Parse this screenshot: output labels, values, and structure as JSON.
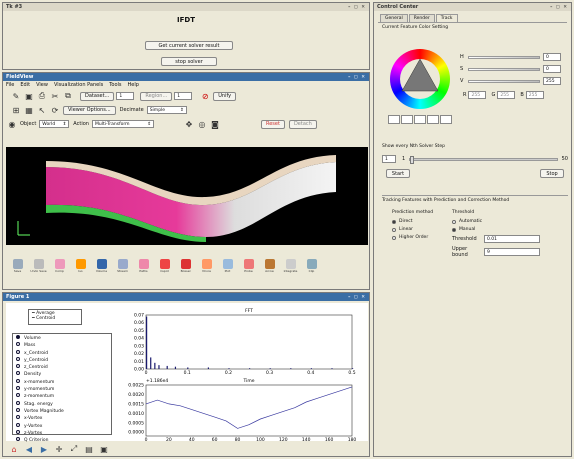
{
  "ifdt": {
    "win_title": "Tk #3",
    "title": "IFDT",
    "btn_get": "Get current solver result",
    "btn_stop": "stop solver"
  },
  "fv": {
    "win_title": "FieldView",
    "menu": [
      "File",
      "Edit",
      "View",
      "Visualization Panels",
      "Tools",
      "Help"
    ],
    "dataset_label": "Dataset...",
    "dataset_val": "1",
    "region_label": "Region...",
    "region_val": "1",
    "unify": "Unify",
    "viewer_options": "Viewer Options...",
    "decimate_label": "Decimate",
    "decimate_val": "Simple",
    "object_label": "Object",
    "object_val": "World",
    "action_label": "Action",
    "action_val": "Multi-Transform",
    "reset": "Reset",
    "detach": "Detach",
    "tools": [
      "Save",
      "Undo Save",
      "Comp",
      "Iso",
      "Volume",
      "Stream",
      "Paths",
      "Cspot",
      "Boxsel",
      "VCore",
      "Plot",
      "Probe",
      "Arrow",
      "Integrate",
      "Clip"
    ]
  },
  "fig": {
    "win_title": "Figure 1",
    "legend": [
      "Average",
      "Centroid"
    ],
    "vars": [
      "Volume",
      "Mass",
      "x_Centroid",
      "y_Centroid",
      "z_Centroid",
      "Density",
      "x-momentum",
      "y-momentum",
      "z-momentum",
      "Stag. energy",
      "Vortex Magnitude",
      "x-Vortex",
      "y-Vortex",
      "z-Vortex",
      "Q Criterion"
    ],
    "fft_title": "FFT",
    "fft_yticks": [
      "0.07",
      "0.06",
      "0.05",
      "0.04",
      "0.03",
      "0.02",
      "0.01",
      "0.00"
    ],
    "fft_xticks": [
      "0",
      "0.1",
      "0.2",
      "0.3",
      "0.4",
      "0.5"
    ],
    "time_title": "Time",
    "time_exp": "+1.186e4",
    "time_yticks": [
      "0.0025",
      "0.0020",
      "0.0015",
      "0.0010",
      "0.0005",
      "0.0000"
    ],
    "time_xticks": [
      "0",
      "20",
      "40",
      "60",
      "80",
      "100",
      "120",
      "140",
      "160",
      "180"
    ]
  },
  "cc": {
    "win_title": "Control Center",
    "tabs": [
      "General",
      "Render",
      "Track"
    ],
    "color_title": "Current Feature Color Setting",
    "hsv": [
      {
        "l": "H",
        "v": "0"
      },
      {
        "l": "S",
        "v": "0"
      },
      {
        "l": "V",
        "v": "255"
      }
    ],
    "rgb": [
      {
        "l": "R",
        "v": "255"
      },
      {
        "l": "G",
        "v": "255"
      },
      {
        "l": "B",
        "v": "255"
      }
    ],
    "step_title": "Show every Nth Solver Step",
    "step_val": "1",
    "step_min": "1",
    "step_max": "50",
    "start": "Start",
    "stop": "Stop",
    "track_title": "Tracking Features with Prediction and Correction Method",
    "pred_title": "Prediction method",
    "pred": [
      "Direct",
      "Linear",
      "Higher Order"
    ],
    "thr_title": "Threshold",
    "thr_opts": [
      "Automatic",
      "Manual"
    ],
    "thr_label": "Threshold",
    "thr_val": "0.01",
    "ub_label": "Upper bound",
    "ub_val": "9"
  },
  "chart_data": [
    {
      "type": "bar",
      "title": "FFT",
      "x": [
        0,
        0.01,
        0.02,
        0.03,
        0.05,
        0.07,
        0.1,
        0.15,
        0.2,
        0.25,
        0.3,
        0.35,
        0.4,
        0.45,
        0.5
      ],
      "values": [
        0.068,
        0.015,
        0.008,
        0.005,
        0.004,
        0.003,
        0.002,
        0.002,
        0.001,
        0.001,
        0.001,
        0.001,
        0.001,
        0.001,
        0.001
      ],
      "xlim": [
        0,
        0.5
      ],
      "ylim": [
        0,
        0.07
      ]
    },
    {
      "type": "line",
      "title": "Time",
      "x": [
        0,
        10,
        20,
        30,
        40,
        50,
        60,
        70,
        80,
        90,
        100,
        110,
        120,
        130,
        140,
        150,
        160,
        170,
        180
      ],
      "values": [
        0.0017,
        0.0019,
        0.0017,
        0.0016,
        0.0014,
        0.0012,
        0.001,
        0.0008,
        0.0004,
        0.0006,
        0.0009,
        0.0011,
        0.0013,
        0.0015,
        0.0018,
        0.002,
        0.0022,
        0.0024,
        0.0026
      ],
      "xlim": [
        0,
        180
      ],
      "ylim": [
        0,
        0.0027
      ]
    }
  ]
}
